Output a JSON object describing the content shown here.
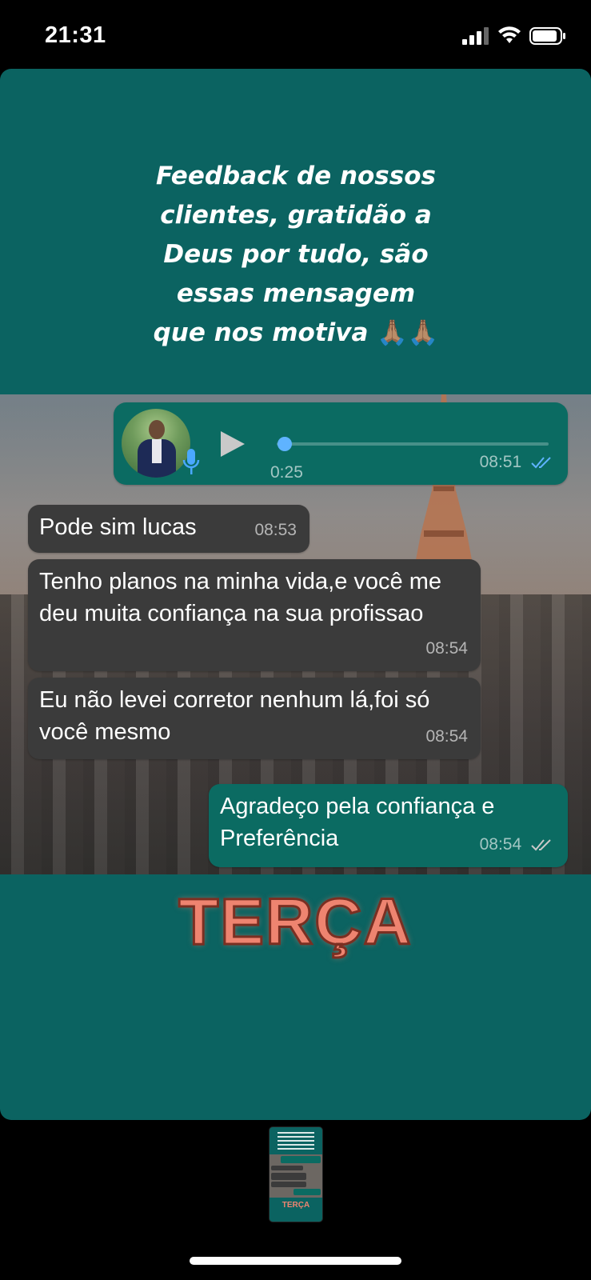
{
  "status_bar": {
    "time": "21:31"
  },
  "story": {
    "caption_lines": [
      "Feedback de nossos",
      "clientes, gratidão a",
      "Deus por tudo, são",
      "essas mensagem",
      "que nos motiva"
    ],
    "caption_emoji": "🙏🏽🙏🏽",
    "week_day": "TERÇA"
  },
  "chat": {
    "voice_message": {
      "duration": "0:25",
      "time": "08:51",
      "progress": 0.02
    },
    "messages": [
      {
        "direction": "in",
        "text": "Pode sim lucas",
        "time": "08:53"
      },
      {
        "direction": "in",
        "text": "Tenho planos na minha vida,e você me deu muita confiança na sua profissao",
        "time": "08:54"
      },
      {
        "direction": "in",
        "text": "Eu não levei corretor nenhum lá,foi só você mesmo",
        "time": "08:54"
      },
      {
        "direction": "out",
        "text": "Agradeço pela confiança e Preferência",
        "time": "08:54"
      }
    ]
  },
  "thumbnail": {
    "label": "TERÇA"
  },
  "colors": {
    "story_background": "#0b6361",
    "incoming_bubble": "#3b3b3b",
    "outgoing_bubble": "#0b6b62",
    "week_day_text": "#ee8470",
    "voice_progress": "#5fb3ff"
  }
}
